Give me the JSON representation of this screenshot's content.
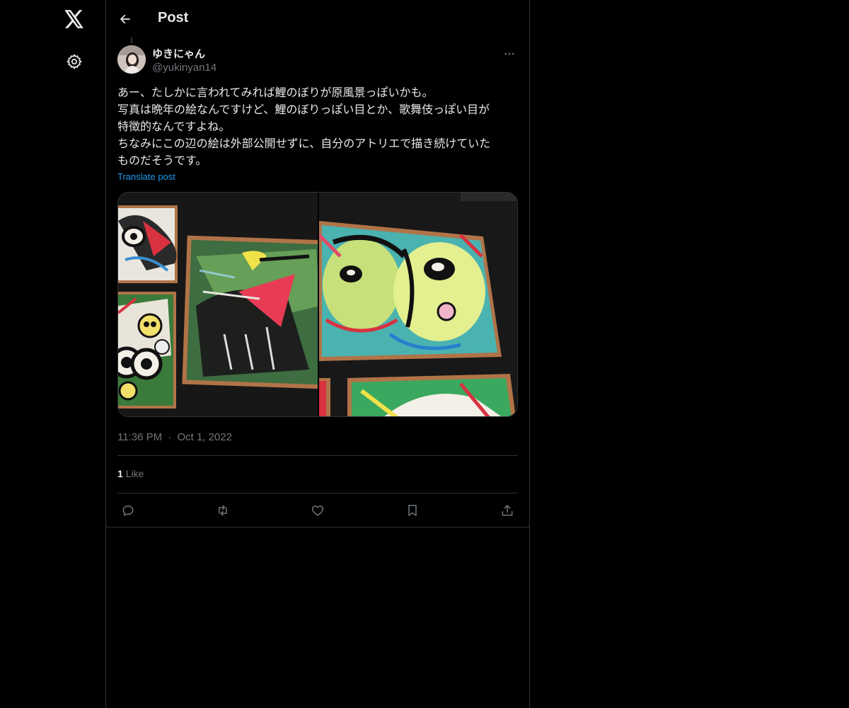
{
  "nav": {
    "logo_icon": "x-logo-icon",
    "settings_icon": "gear-icon"
  },
  "header": {
    "back_icon": "arrow-left-icon",
    "title": "Post"
  },
  "post": {
    "author": {
      "display_name": "ゆきにゃん",
      "handle": "@yukinyan14"
    },
    "more_icon": "ellipsis-icon",
    "text_lines": [
      "あー、たしかに言われてみれば鯉のぼりが原風景っぽいかも。",
      "写真は晩年の絵なんですけど、鯉のぼりっぽい目とか、歌舞伎っぽい目が",
      "特徴的なんですよね。",
      "ちなみにこの辺の絵は外部公開せずに、自分のアトリエで描き続けていた",
      "ものだそうです。"
    ],
    "translate_label": "Translate post",
    "time": "11:36 PM",
    "separator": "·",
    "date": "Oct 1, 2022",
    "likes_count": "1",
    "likes_label": "Like",
    "actions": {
      "reply_icon": "reply-icon",
      "repost_icon": "repost-icon",
      "like_icon": "heart-icon",
      "bookmark_icon": "bookmark-icon",
      "share_icon": "share-icon"
    }
  },
  "colors": {
    "background": "#000000",
    "text": "#e7e9ea",
    "muted": "#71767b",
    "accent": "#1d9bf0",
    "border": "#2f3336"
  }
}
